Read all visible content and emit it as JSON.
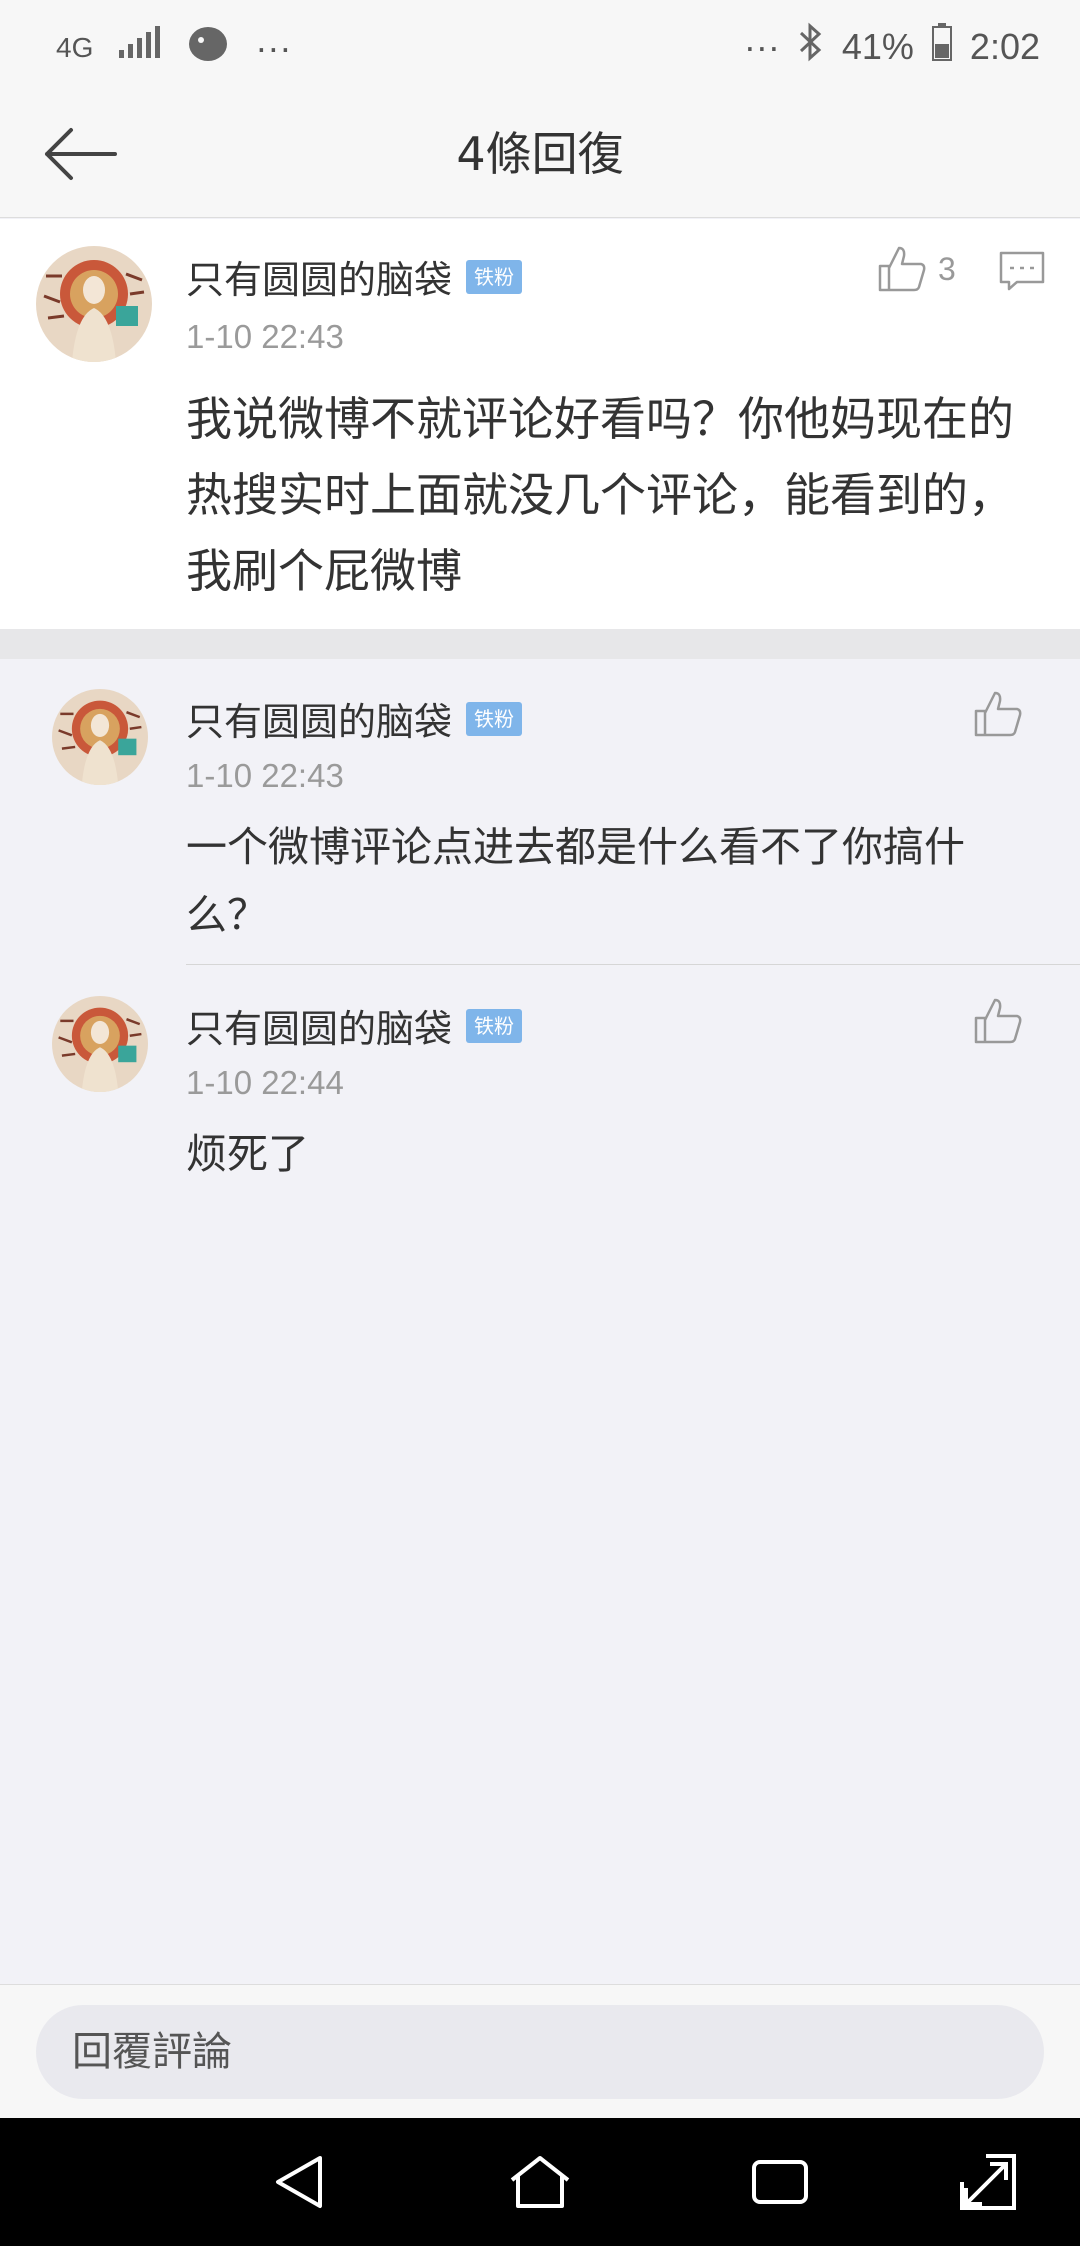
{
  "status_bar": {
    "network": "4G",
    "battery": "41%",
    "time": "2:02",
    "icons": [
      "signal-icon",
      "app-notification-icon",
      "more-dots-icon",
      "bluetooth-icon",
      "battery-icon"
    ]
  },
  "nav": {
    "title": "4條回復"
  },
  "main_comment": {
    "author": "只有圆圆的脑袋",
    "badge": "铁粉",
    "time": "1-10 22:43",
    "text": "我说微博不就评论好看吗？你他妈现在的热搜实时上面就没几个评论，能看到的，我刷个屁微博",
    "likes": "3"
  },
  "replies": [
    {
      "author": "只有圆圆的脑袋",
      "badge": "铁粉",
      "time": "1-10 22:43",
      "text": "一个微博评论点进去都是什么看不了你搞什么？"
    },
    {
      "author": "只有圆圆的脑袋",
      "badge": "铁粉",
      "time": "1-10 22:44",
      "text": "烦死了"
    }
  ],
  "reply_input": {
    "placeholder": "回覆評論"
  },
  "colors": {
    "badge": "#7fb5ea",
    "background": "#f2f2f7",
    "system_nav": "#000000"
  }
}
